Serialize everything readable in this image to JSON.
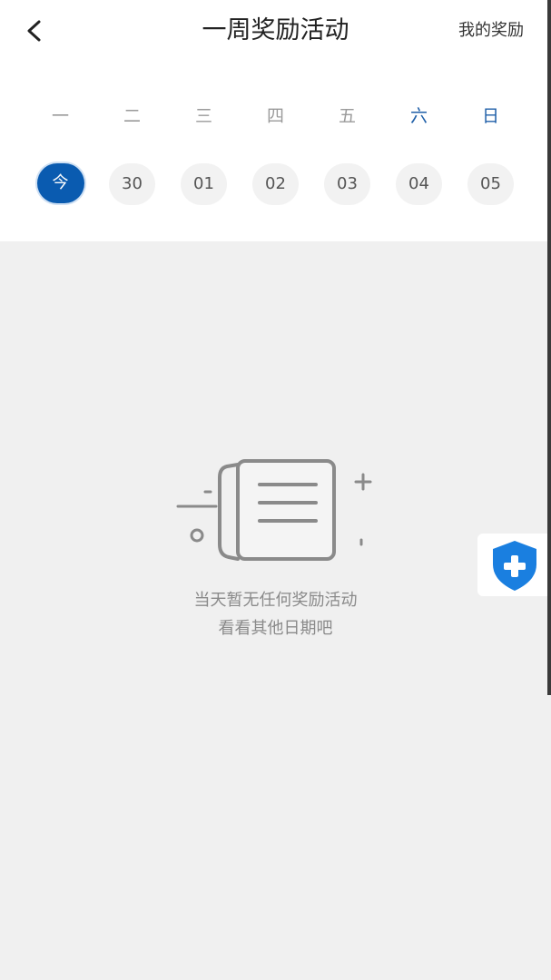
{
  "header": {
    "title": "一周奖励活动",
    "my_rewards": "我的奖励",
    "back_icon": "chevron-left-icon"
  },
  "calendar": {
    "weekdays": [
      "一",
      "二",
      "三",
      "四",
      "五",
      "六",
      "日"
    ],
    "dates": [
      "今",
      "30",
      "01",
      "02",
      "03",
      "04",
      "05"
    ],
    "selected": "今"
  },
  "empty_state": {
    "icon": "empty-document-icon",
    "line1": "当天暂无任何奖励活动",
    "line2": "看看其他日期吧"
  },
  "floating_button": {
    "icon": "shield-plus-icon"
  },
  "colors": {
    "accent": "#0a5bb0",
    "weekend": "#1f5fa8",
    "shield": "#1a7fe0",
    "background": "#f0f0f0"
  }
}
